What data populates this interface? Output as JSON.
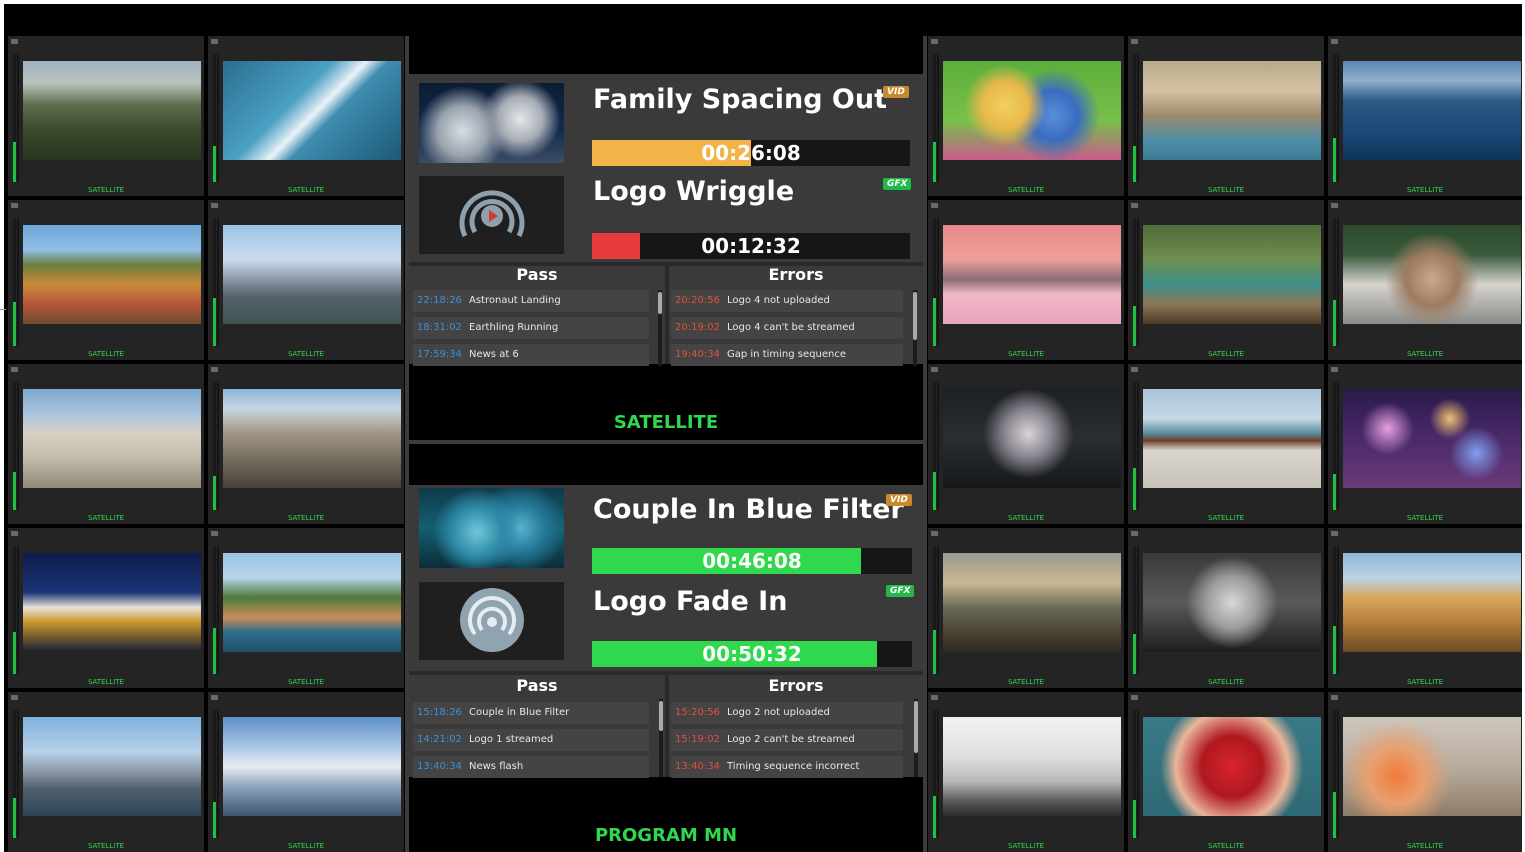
{
  "tiles": {
    "label": "SATELLITE"
  },
  "panel_top": {
    "program1": {
      "title": "Family Spacing Out",
      "badge": "VID",
      "timecode": "00:26:08",
      "progress": 0.5
    },
    "program2": {
      "title": "Logo Wriggle",
      "badge": "GFX",
      "timecode": "00:12:32",
      "progress": 0.15
    },
    "pass_header": "Pass",
    "errors_header": "Errors",
    "pass_rows": [
      {
        "time": "22:18:26",
        "text": "Astronaut Landing"
      },
      {
        "time": "18:31:02",
        "text": "Earthling Running"
      },
      {
        "time": "17:59:34",
        "text": "News at 6"
      }
    ],
    "error_rows": [
      {
        "time": "20:20:56",
        "text": "Logo 4 not uploaded"
      },
      {
        "time": "20:19:02",
        "text": "Logo 4 can't be streamed"
      },
      {
        "time": "19:40:34",
        "text": "Gap in timing sequence"
      }
    ],
    "source_label": "SATELLITE"
  },
  "panel_bottom": {
    "program1": {
      "title": "Couple In Blue Filter",
      "badge": "VID",
      "timecode": "00:46:08",
      "progress": 0.84
    },
    "program2": {
      "title": "Logo Fade In",
      "badge": "GFX",
      "timecode": "00:50:32",
      "progress": 0.89
    },
    "pass_header": "Pass",
    "errors_header": "Errors",
    "pass_rows": [
      {
        "time": "15:18:26",
        "text": "Couple in Blue Filter"
      },
      {
        "time": "14:21:02",
        "text": "Logo 1 streamed"
      },
      {
        "time": "13:40:34",
        "text": "News flash"
      }
    ],
    "error_rows": [
      {
        "time": "15:20:56",
        "text": "Logo 2 not uploaded"
      },
      {
        "time": "15:19:02",
        "text": "Logo 2 can't be streamed"
      },
      {
        "time": "13:40:34",
        "text": "Timing sequence incorrect"
      }
    ],
    "source_label": "PROGRAM MN"
  },
  "colors": {
    "satellite_green": "#2fd84d",
    "vid_badge": "#c78a2c",
    "gfx_badge": "#22b84a",
    "progress_orange": "#f2b347",
    "progress_red": "#e53b3b",
    "progress_green": "#2fd84d",
    "pass_time_blue": "#3b8fd9",
    "error_time_red": "#e0503c"
  }
}
